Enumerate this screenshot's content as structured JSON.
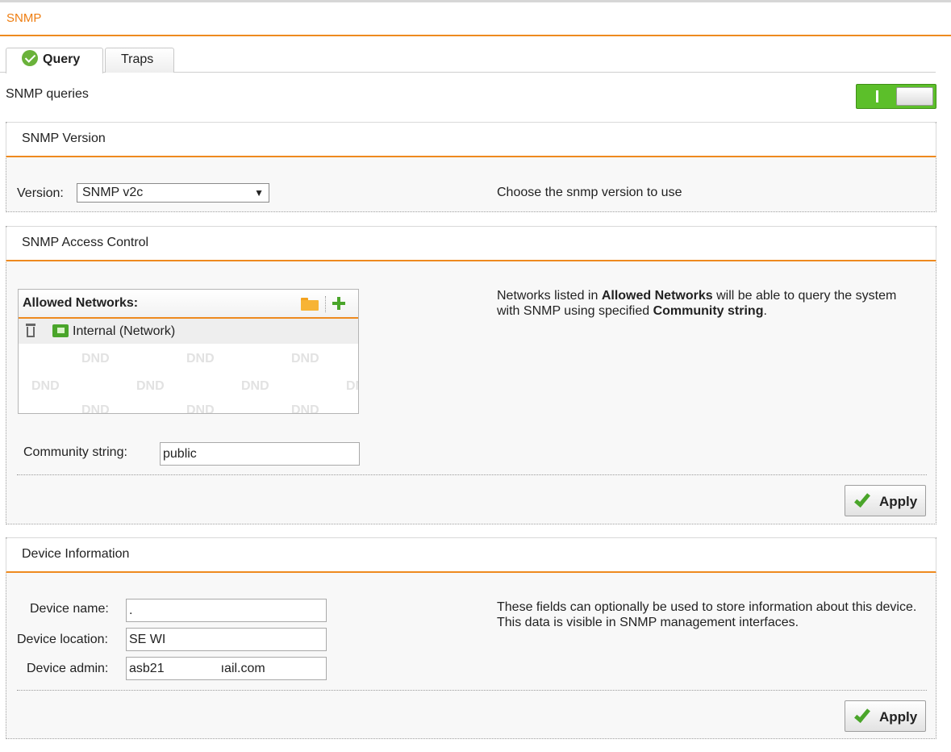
{
  "page": {
    "title": "SNMP"
  },
  "tabs": [
    {
      "label": "Query",
      "active": true
    },
    {
      "label": "Traps",
      "active": false
    }
  ],
  "snmp_queries": {
    "label": "SNMP queries",
    "enabled": true,
    "toggle_on_mark": "I"
  },
  "version_section": {
    "title": "SNMP Version",
    "version_label": "Version:",
    "version_value": "SNMP v2c",
    "dropdown_arrow": "▼",
    "help": "Choose the snmp version to use"
  },
  "access_section": {
    "title": "SNMP Access Control",
    "allowed_networks_title": "Allowed Networks:",
    "networks": [
      {
        "name": "Internal (Network)"
      }
    ],
    "dnd_watermark": "DND",
    "community_label": "Community string:",
    "community_value": "public",
    "help_before": "Networks listed in ",
    "help_bold1": "Allowed Networks",
    "help_middle": " will be able to query the system with SNMP using specified ",
    "help_bold2": "Community string",
    "help_after": ".",
    "apply_label": "Apply"
  },
  "device_section": {
    "title": "Device Information",
    "name_label": "Device name:",
    "name_value": ".",
    "location_label": "Device location:",
    "location_value": "SE WI",
    "admin_label": "Device admin:",
    "admin_value_start": "asb21",
    "admin_value_end": "ıail.com",
    "help": "These fields can optionally be used to store information about this device. This data is visible in SNMP management interfaces.",
    "apply_label": "Apply"
  },
  "colors": {
    "accent": "#ee8a1f",
    "title": "#ee7d10",
    "toggle_on": "#5cbf2a",
    "check": "#4aa52a"
  },
  "icons": [
    "check-circle-icon",
    "folder-icon",
    "plus-icon",
    "trash-icon",
    "network-flag-icon",
    "apply-check-icon",
    "dropdown-arrow-icon"
  ]
}
